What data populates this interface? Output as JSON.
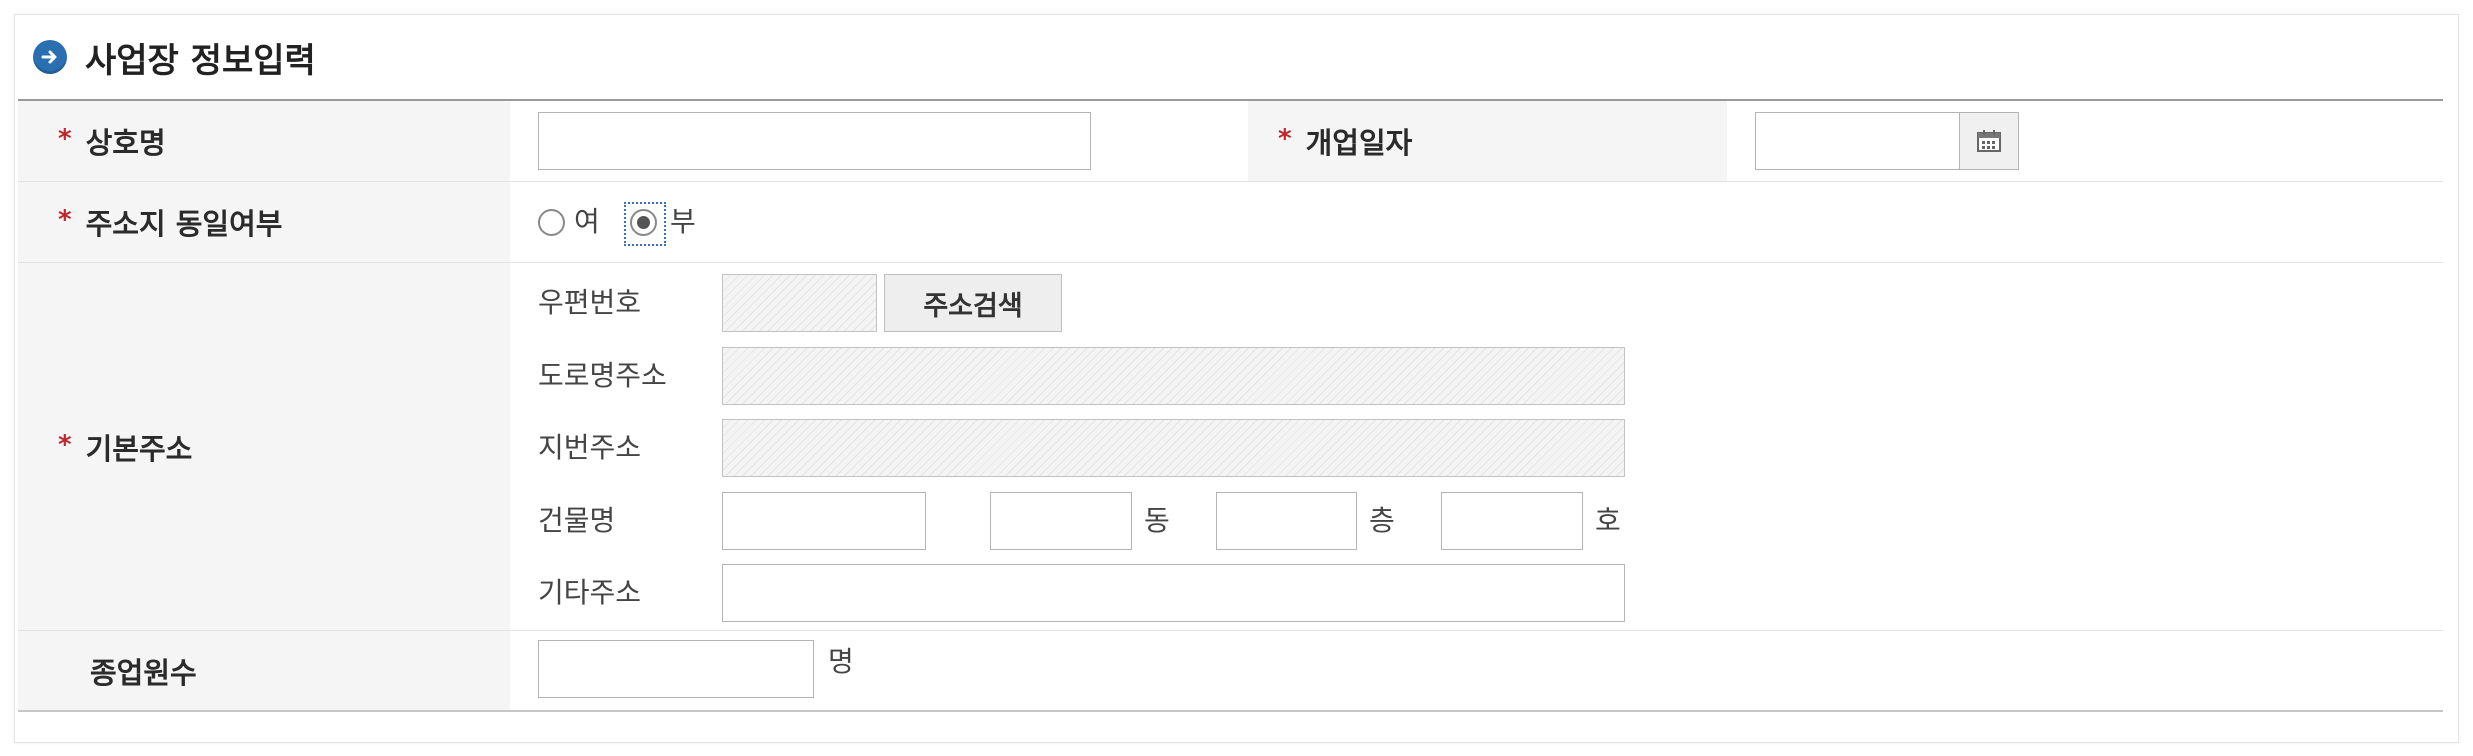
{
  "section": {
    "title": "사업장 정보입력"
  },
  "required_mark": "*",
  "rows": {
    "trade_name": {
      "label": "상호명",
      "value": ""
    },
    "opening_date": {
      "label": "개업일자",
      "value": ""
    },
    "same_address": {
      "label": "주소지 동일여부",
      "options": [
        "여",
        "부"
      ],
      "selected": "부"
    },
    "base_address": {
      "label": "기본주소",
      "postal_code_label": "우편번호",
      "postal_code_value": "",
      "search_button": "주소검색",
      "road_address_label": "도로명주소",
      "road_address_value": "",
      "lot_address_label": "지번주소",
      "lot_address_value": "",
      "building_label": "건물명",
      "building_value": "",
      "dong_value": "",
      "dong_unit": "동",
      "floor_value": "",
      "floor_unit": "층",
      "room_value": "",
      "room_unit": "호",
      "other_label": "기타주소",
      "other_value": ""
    },
    "employees": {
      "label": "종업원수",
      "value": "",
      "unit": "명"
    }
  },
  "icons": {
    "title": "arrow-circle-icon",
    "calendar": "calendar-icon"
  },
  "colors": {
    "title_icon": "#2a6fb0",
    "required": "#c0272d",
    "header_bg": "#f5f5f5"
  }
}
